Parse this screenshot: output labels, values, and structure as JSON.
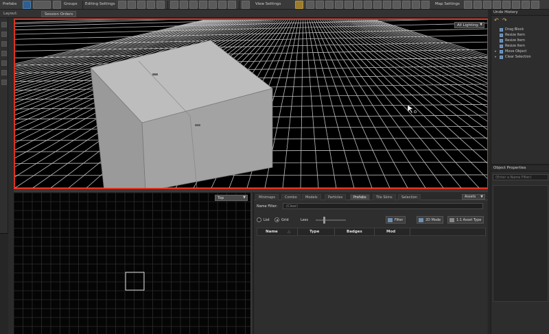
{
  "toolbar": {
    "prefabs_label": "Prefabs",
    "groups_label": "Groups",
    "editing_settings_label": "Editing Settings",
    "view_settings_label": "View Settings",
    "map_settings_label": "Map Settings"
  },
  "layout": {
    "label": "Layout:",
    "tab": "Session Orders"
  },
  "viewport3d": {
    "lighting": "All Lighting"
  },
  "viewport2d": {
    "view": "Top"
  },
  "asset_browser": {
    "tabs": [
      "Minimaps",
      "Combo",
      "Models",
      "Particles",
      "Prefabs",
      "Tile Skins",
      "Selection"
    ],
    "active_tab": "Prefabs",
    "menu_dd": "Assets",
    "name_filter_label": "Name Filter:",
    "name_filter_placeholder": "(Clear)",
    "list_label": "List",
    "grid_label": "Grid",
    "less_label": "Less",
    "filter_button": "Filter",
    "mode_button": "2D Mode",
    "asset_type_button": "1:1 Asset Type",
    "columns": [
      "Name",
      "Type",
      "Badges",
      "Mod"
    ]
  },
  "undo_history": {
    "title": "Undo History",
    "items": [
      "Drag Block",
      "Resize Item",
      "Resize Item",
      "Resize Item",
      "Move Object",
      "Clear Selection"
    ]
  },
  "object_properties": {
    "title": "Object Properties",
    "filter_placeholder": "(Enter a Name Filter)"
  }
}
